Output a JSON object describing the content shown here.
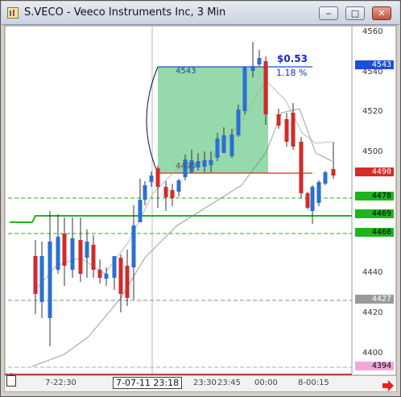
{
  "window": {
    "title": "S.VECO - Veeco Instruments Inc, 3 Min",
    "buttons": {
      "minimize": "‒",
      "maximize": "□",
      "close": "✕"
    }
  },
  "price_axis": {
    "ticks": [
      "4560",
      "4540",
      "4520",
      "4500",
      "4440",
      "4420",
      "4400"
    ],
    "tags": [
      {
        "value": "4543",
        "bg": "#1d4fd8",
        "fg": "#ffffff"
      },
      {
        "value": "4490",
        "bg": "#d62b2b",
        "fg": "#ffffff"
      },
      {
        "value": "4478",
        "bg": "#1db41d",
        "fg": "#000000"
      },
      {
        "value": "4469",
        "bg": "#1db41d",
        "fg": "#000000"
      },
      {
        "value": "4460",
        "bg": "#1db41d",
        "fg": "#000000"
      },
      {
        "value": "4427",
        "bg": "#9a9a9a",
        "fg": "#ffffff"
      },
      {
        "value": "4394",
        "bg": "#f0a8d8",
        "fg": "#000000"
      }
    ]
  },
  "time_axis": {
    "labels": [
      "7-22:30",
      "23:30",
      "23:45",
      "00:00",
      "8-00:15"
    ],
    "cursor_label": "7-07-11 23:18"
  },
  "measurement": {
    "delta": "$0.53",
    "percent": "1.18 %",
    "box_high": "4543",
    "box_low": "4490"
  },
  "colors": {
    "up": "#2a6fd6",
    "down": "#d42a2a",
    "green_line": "#1db41d",
    "box_fill": "#7ccf96"
  },
  "icons": {
    "scroll_right": "red-right-arrow-icon",
    "app": "chart-app-icon"
  }
}
